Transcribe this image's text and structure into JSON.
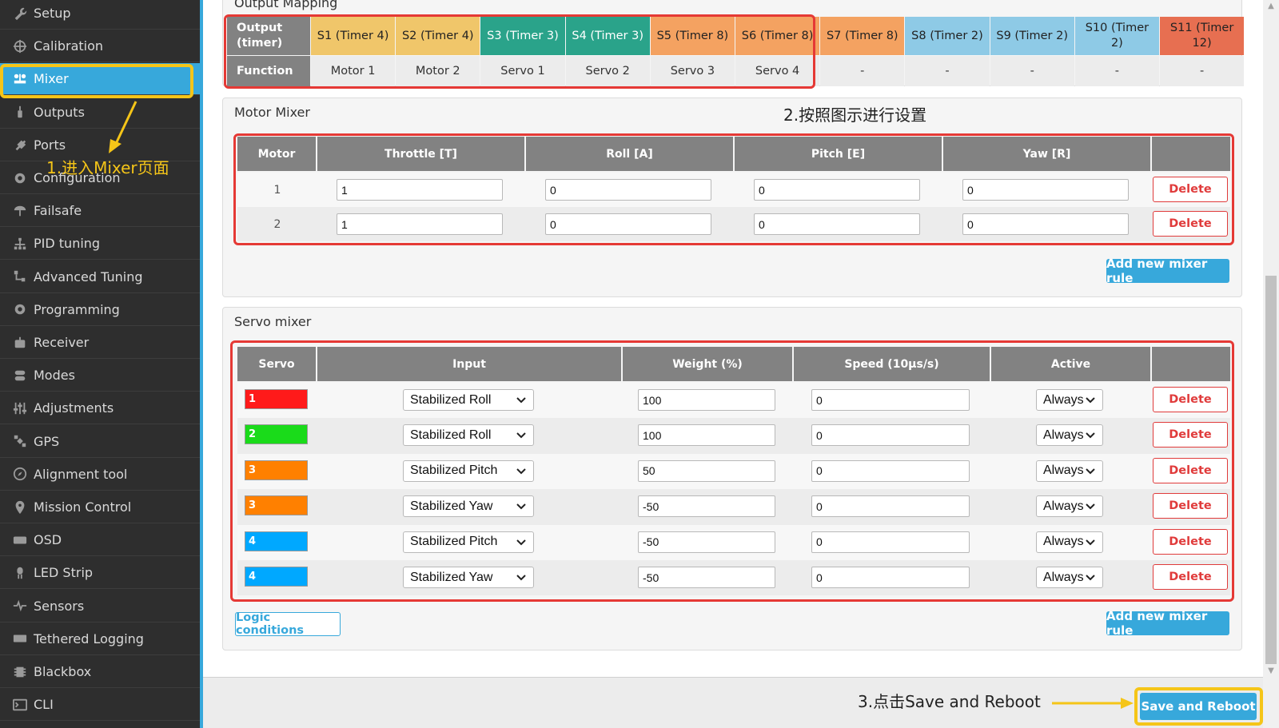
{
  "sidebar": {
    "items": [
      {
        "label": "Setup",
        "icon": "wrench-icon"
      },
      {
        "label": "Calibration",
        "icon": "crosshair-icon"
      },
      {
        "label": "Mixer",
        "icon": "mixer-icon",
        "active": true
      },
      {
        "label": "Outputs",
        "icon": "motor-icon"
      },
      {
        "label": "Ports",
        "icon": "plug-icon"
      },
      {
        "label": "Configuration",
        "icon": "gear-icon"
      },
      {
        "label": "Failsafe",
        "icon": "parachute-icon"
      },
      {
        "label": "PID tuning",
        "icon": "tree-icon"
      },
      {
        "label": "Advanced Tuning",
        "icon": "hierarchy-icon"
      },
      {
        "label": "Programming",
        "icon": "gear-icon"
      },
      {
        "label": "Receiver",
        "icon": "robot-icon"
      },
      {
        "label": "Modes",
        "icon": "toggle-icon"
      },
      {
        "label": "Adjustments",
        "icon": "sliders-icon"
      },
      {
        "label": "GPS",
        "icon": "satellite-icon"
      },
      {
        "label": "Alignment tool",
        "icon": "compass-icon"
      },
      {
        "label": "Mission Control",
        "icon": "map-pin-icon"
      },
      {
        "label": "OSD",
        "icon": "osd-icon"
      },
      {
        "label": "LED Strip",
        "icon": "led-icon"
      },
      {
        "label": "Sensors",
        "icon": "pulse-icon"
      },
      {
        "label": "Tethered Logging",
        "icon": "keyboard-icon"
      },
      {
        "label": "Blackbox",
        "icon": "chip-icon"
      },
      {
        "label": "CLI",
        "icon": "terminal-icon"
      }
    ]
  },
  "output_mapping": {
    "title": "Output Mapping",
    "row_labels": {
      "output": "Output (timer)",
      "function": "Function"
    },
    "columns": [
      {
        "output": "S1 (Timer 4)",
        "function": "Motor 1",
        "color": "#f0c66a"
      },
      {
        "output": "S2 (Timer 4)",
        "function": "Motor 2",
        "color": "#f0c66a"
      },
      {
        "output": "S3 (Timer 3)",
        "function": "Servo 1",
        "color": "#2aa38a"
      },
      {
        "output": "S4 (Timer 3)",
        "function": "Servo 2",
        "color": "#2aa38a"
      },
      {
        "output": "S5 (Timer 8)",
        "function": "Servo 3",
        "color": "#f4a261"
      },
      {
        "output": "S6 (Timer 8)",
        "function": "Servo 4",
        "color": "#f4a261"
      },
      {
        "output": "S7 (Timer 8)",
        "function": "-",
        "color": "#f4a261"
      },
      {
        "output": "S8 (Timer 2)",
        "function": "-",
        "color": "#8ecae6"
      },
      {
        "output": "S9 (Timer 2)",
        "function": "-",
        "color": "#8ecae6"
      },
      {
        "output": "S10 (Timer 2)",
        "function": "-",
        "color": "#8ecae6"
      },
      {
        "output": "S11 (Timer 12)",
        "function": "-",
        "color": "#e76f51"
      }
    ]
  },
  "motor_mixer": {
    "title": "Motor Mixer",
    "headers": [
      "Motor",
      "Throttle [T]",
      "Roll [A]",
      "Pitch [E]",
      "Yaw [R]"
    ],
    "rows": [
      {
        "motor": "1",
        "throttle": "1",
        "roll": "0",
        "pitch": "0",
        "yaw": "0"
      },
      {
        "motor": "2",
        "throttle": "1",
        "roll": "0",
        "pitch": "0",
        "yaw": "0"
      }
    ],
    "delete_label": "Delete",
    "add_rule_label": "Add new mixer rule"
  },
  "servo_mixer": {
    "title": "Servo mixer",
    "headers": [
      "Servo",
      "Input",
      "Weight (%)",
      "Speed (10µs/s)",
      "Active"
    ],
    "rows": [
      {
        "servo": "1",
        "color": "#ff1a1a",
        "input": "Stabilized Roll",
        "weight": "100",
        "speed": "0",
        "active": "Always"
      },
      {
        "servo": "2",
        "color": "#1adb1a",
        "input": "Stabilized Roll",
        "weight": "100",
        "speed": "0",
        "active": "Always"
      },
      {
        "servo": "3",
        "color": "#ff8000",
        "input": "Stabilized Pitch",
        "weight": "50",
        "speed": "0",
        "active": "Always"
      },
      {
        "servo": "3",
        "color": "#ff8000",
        "input": "Stabilized Yaw",
        "weight": "-50",
        "speed": "0",
        "active": "Always"
      },
      {
        "servo": "4",
        "color": "#00a8ff",
        "input": "Stabilized Pitch",
        "weight": "-50",
        "speed": "0",
        "active": "Always"
      },
      {
        "servo": "4",
        "color": "#00a8ff",
        "input": "Stabilized Yaw",
        "weight": "-50",
        "speed": "0",
        "active": "Always"
      }
    ],
    "delete_label": "Delete",
    "logic_conditions_label": "Logic conditions",
    "add_rule_label": "Add new mixer rule"
  },
  "footer": {
    "save_reboot_label": "Save and Reboot"
  },
  "annotations": {
    "step1": "1.进入Mixer页面",
    "step2": "2.按照图示进行设置",
    "step3": "3.点击Save and Reboot"
  },
  "colors": {
    "accent": "#37a8db",
    "highlight": "#e53935",
    "callout": "#f5c518",
    "sidebar": "#2e2e2e"
  }
}
